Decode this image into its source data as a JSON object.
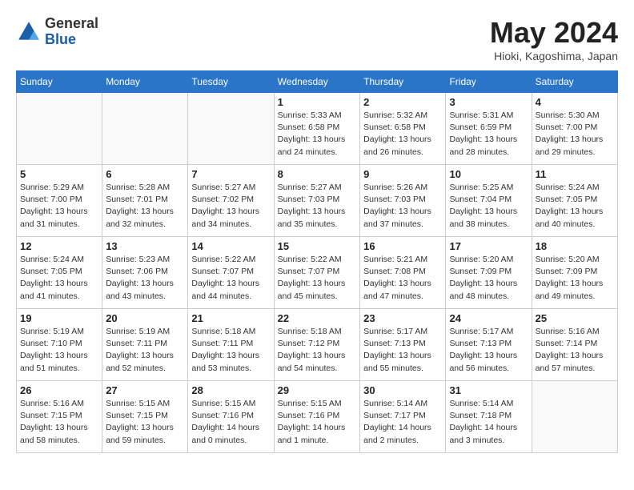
{
  "header": {
    "logo_general": "General",
    "logo_blue": "Blue",
    "month_title": "May 2024",
    "location": "Hioki, Kagoshima, Japan"
  },
  "days_of_week": [
    "Sunday",
    "Monday",
    "Tuesday",
    "Wednesday",
    "Thursday",
    "Friday",
    "Saturday"
  ],
  "weeks": [
    [
      {
        "day": "",
        "info": ""
      },
      {
        "day": "",
        "info": ""
      },
      {
        "day": "",
        "info": ""
      },
      {
        "day": "1",
        "info": "Sunrise: 5:33 AM\nSunset: 6:58 PM\nDaylight: 13 hours\nand 24 minutes."
      },
      {
        "day": "2",
        "info": "Sunrise: 5:32 AM\nSunset: 6:58 PM\nDaylight: 13 hours\nand 26 minutes."
      },
      {
        "day": "3",
        "info": "Sunrise: 5:31 AM\nSunset: 6:59 PM\nDaylight: 13 hours\nand 28 minutes."
      },
      {
        "day": "4",
        "info": "Sunrise: 5:30 AM\nSunset: 7:00 PM\nDaylight: 13 hours\nand 29 minutes."
      }
    ],
    [
      {
        "day": "5",
        "info": "Sunrise: 5:29 AM\nSunset: 7:00 PM\nDaylight: 13 hours\nand 31 minutes."
      },
      {
        "day": "6",
        "info": "Sunrise: 5:28 AM\nSunset: 7:01 PM\nDaylight: 13 hours\nand 32 minutes."
      },
      {
        "day": "7",
        "info": "Sunrise: 5:27 AM\nSunset: 7:02 PM\nDaylight: 13 hours\nand 34 minutes."
      },
      {
        "day": "8",
        "info": "Sunrise: 5:27 AM\nSunset: 7:03 PM\nDaylight: 13 hours\nand 35 minutes."
      },
      {
        "day": "9",
        "info": "Sunrise: 5:26 AM\nSunset: 7:03 PM\nDaylight: 13 hours\nand 37 minutes."
      },
      {
        "day": "10",
        "info": "Sunrise: 5:25 AM\nSunset: 7:04 PM\nDaylight: 13 hours\nand 38 minutes."
      },
      {
        "day": "11",
        "info": "Sunrise: 5:24 AM\nSunset: 7:05 PM\nDaylight: 13 hours\nand 40 minutes."
      }
    ],
    [
      {
        "day": "12",
        "info": "Sunrise: 5:24 AM\nSunset: 7:05 PM\nDaylight: 13 hours\nand 41 minutes."
      },
      {
        "day": "13",
        "info": "Sunrise: 5:23 AM\nSunset: 7:06 PM\nDaylight: 13 hours\nand 43 minutes."
      },
      {
        "day": "14",
        "info": "Sunrise: 5:22 AM\nSunset: 7:07 PM\nDaylight: 13 hours\nand 44 minutes."
      },
      {
        "day": "15",
        "info": "Sunrise: 5:22 AM\nSunset: 7:07 PM\nDaylight: 13 hours\nand 45 minutes."
      },
      {
        "day": "16",
        "info": "Sunrise: 5:21 AM\nSunset: 7:08 PM\nDaylight: 13 hours\nand 47 minutes."
      },
      {
        "day": "17",
        "info": "Sunrise: 5:20 AM\nSunset: 7:09 PM\nDaylight: 13 hours\nand 48 minutes."
      },
      {
        "day": "18",
        "info": "Sunrise: 5:20 AM\nSunset: 7:09 PM\nDaylight: 13 hours\nand 49 minutes."
      }
    ],
    [
      {
        "day": "19",
        "info": "Sunrise: 5:19 AM\nSunset: 7:10 PM\nDaylight: 13 hours\nand 51 minutes."
      },
      {
        "day": "20",
        "info": "Sunrise: 5:19 AM\nSunset: 7:11 PM\nDaylight: 13 hours\nand 52 minutes."
      },
      {
        "day": "21",
        "info": "Sunrise: 5:18 AM\nSunset: 7:11 PM\nDaylight: 13 hours\nand 53 minutes."
      },
      {
        "day": "22",
        "info": "Sunrise: 5:18 AM\nSunset: 7:12 PM\nDaylight: 13 hours\nand 54 minutes."
      },
      {
        "day": "23",
        "info": "Sunrise: 5:17 AM\nSunset: 7:13 PM\nDaylight: 13 hours\nand 55 minutes."
      },
      {
        "day": "24",
        "info": "Sunrise: 5:17 AM\nSunset: 7:13 PM\nDaylight: 13 hours\nand 56 minutes."
      },
      {
        "day": "25",
        "info": "Sunrise: 5:16 AM\nSunset: 7:14 PM\nDaylight: 13 hours\nand 57 minutes."
      }
    ],
    [
      {
        "day": "26",
        "info": "Sunrise: 5:16 AM\nSunset: 7:15 PM\nDaylight: 13 hours\nand 58 minutes."
      },
      {
        "day": "27",
        "info": "Sunrise: 5:15 AM\nSunset: 7:15 PM\nDaylight: 13 hours\nand 59 minutes."
      },
      {
        "day": "28",
        "info": "Sunrise: 5:15 AM\nSunset: 7:16 PM\nDaylight: 14 hours\nand 0 minutes."
      },
      {
        "day": "29",
        "info": "Sunrise: 5:15 AM\nSunset: 7:16 PM\nDaylight: 14 hours\nand 1 minute."
      },
      {
        "day": "30",
        "info": "Sunrise: 5:14 AM\nSunset: 7:17 PM\nDaylight: 14 hours\nand 2 minutes."
      },
      {
        "day": "31",
        "info": "Sunrise: 5:14 AM\nSunset: 7:18 PM\nDaylight: 14 hours\nand 3 minutes."
      },
      {
        "day": "",
        "info": ""
      }
    ]
  ]
}
